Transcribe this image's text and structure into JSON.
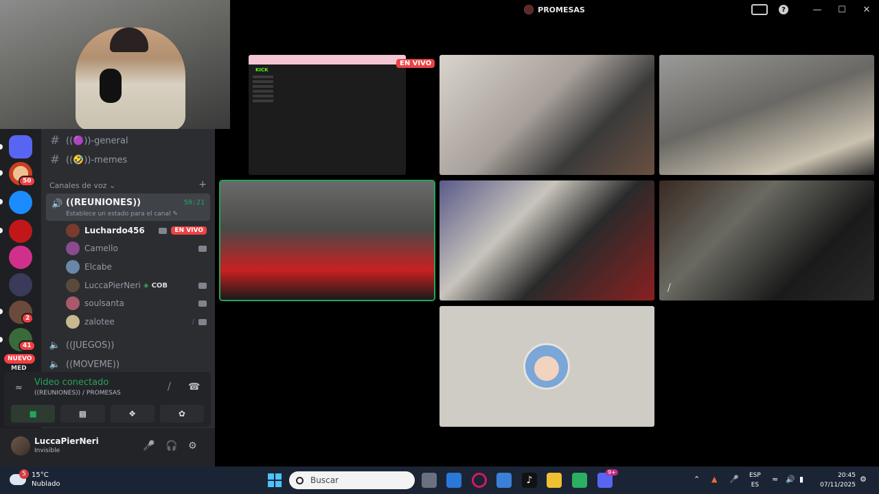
{
  "window": {
    "title": "PROMESAS"
  },
  "server_rail": {
    "badges": [
      "50",
      "2",
      "41"
    ],
    "nuevo_label": "NUEVO",
    "partial_label": "MED"
  },
  "channels": {
    "text": [
      {
        "label": "((🟣))-general"
      },
      {
        "label": "((🤣))-memes"
      }
    ],
    "voice_section_label": "Canales de voz",
    "active_voice": {
      "name": "((REUNIONES))",
      "timer": "50:21",
      "status": "Establece un estado para el canal"
    },
    "members": [
      {
        "name": "Luchardo456",
        "live": "EN VIVO",
        "color": "#7a3b2e"
      },
      {
        "name": "Camello",
        "color": "#8b4a8e"
      },
      {
        "name": "Elcabe",
        "color": "#6a86a8"
      },
      {
        "name": "LuccaPierNeri",
        "tag": "COB",
        "color": "#5a4a3e"
      },
      {
        "name": "soulsanta",
        "color": "#a85a6a"
      },
      {
        "name": "zalotee",
        "color": "#c8b890"
      }
    ],
    "other_voice": [
      {
        "label": "((JUEGOS))"
      },
      {
        "label": "((MOVEME))"
      }
    ]
  },
  "voice_panel": {
    "title": "Video conectado",
    "subtitle": "((REUNIONES)) / PROMESAS"
  },
  "user_panel": {
    "name": "LuccaPierNeri",
    "status": "Invisible"
  },
  "stage": {
    "live_badge": "EN VIVO"
  },
  "taskbar": {
    "weather_temp": "15°C",
    "weather_desc": "Nublado",
    "weather_badge": "5",
    "search_placeholder": "Buscar",
    "lang_line1": "ESP",
    "lang_line2": "ES",
    "time": "20:45",
    "date": "07/11/2025",
    "discord_badge": "9+"
  },
  "colors": {
    "accent_green": "#23a55a",
    "live_red": "#ed4245",
    "sidebar_bg": "#2b2d31",
    "rail_bg": "#1e1f22"
  }
}
